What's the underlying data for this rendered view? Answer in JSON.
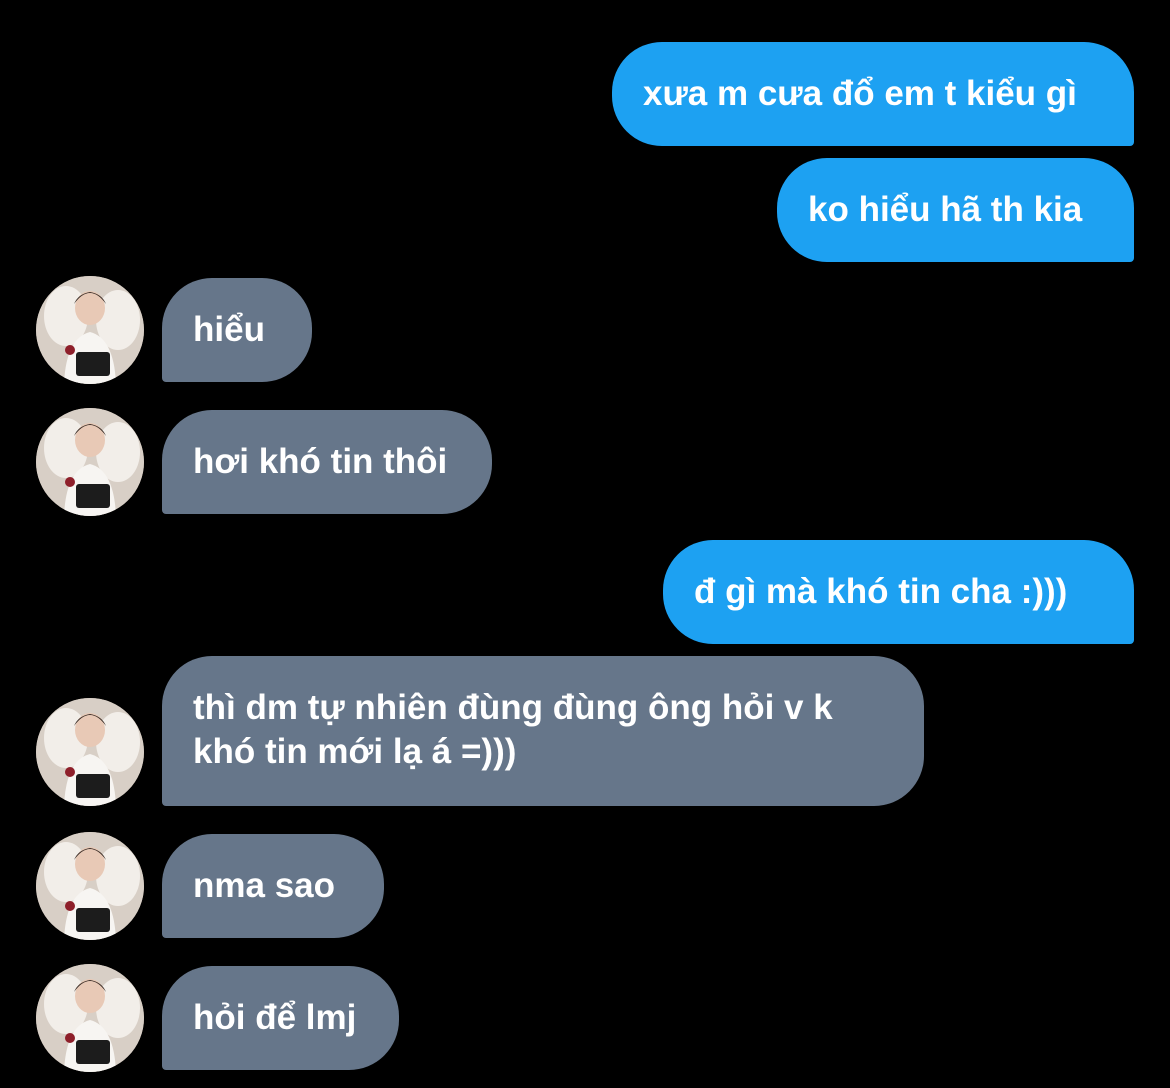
{
  "messages": [
    {
      "side": "out",
      "text": "xưa m cưa đổ em t kiểu gì"
    },
    {
      "side": "out",
      "text": "ko hiểu hã th kia"
    },
    {
      "side": "in",
      "text": "hiểu"
    },
    {
      "side": "in",
      "text": "hơi khó tin thôi"
    },
    {
      "side": "out",
      "text": "đ gì mà khó tin cha :)))"
    },
    {
      "side": "in",
      "text": "thì dm tự nhiên đùng đùng ông hỏi v k\nkhó tin mới lạ á =)))"
    },
    {
      "side": "in",
      "text": "nma sao"
    },
    {
      "side": "in",
      "text": "hỏi để lmj"
    }
  ],
  "colors": {
    "background": "#000000",
    "outgoing_bubble": "#1da1f2",
    "incoming_bubble": "#66768a",
    "text": "#ffffff"
  },
  "icons": {
    "avatar": "contact-avatar-photo"
  }
}
